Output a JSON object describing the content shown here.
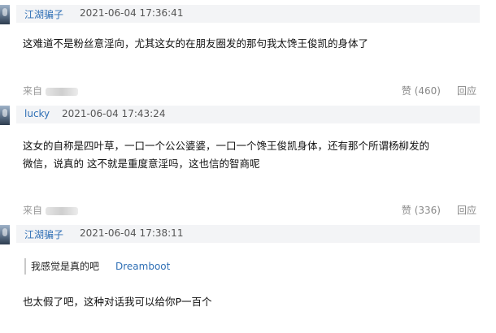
{
  "comments": [
    {
      "username": "江湖骗子",
      "time": "2021-06-04 17:36:41",
      "text": "这难道不是粉丝意淫向，尤其这女的在朋友圈发的那句我太馋王俊凯的身体了",
      "source": "来自",
      "like": "赞 (460)",
      "reply": "回应"
    },
    {
      "username": "lucky",
      "time": "2021-06-04 17:43:24",
      "text_line1": "这女的自称是四叶草，一口一个公公婆婆，一口一个馋王俊凯身体，还有那个所谓杨柳发的",
      "text_line2": "微信，说真的 这不就是重度意淫吗，这也信的智商呢",
      "source": "来自",
      "like": "赞 (336)",
      "reply": "回应"
    },
    {
      "username": "江湖骗子",
      "time": "2021-06-04 17:38:11",
      "quote_text": "我感觉是真的吧",
      "quote_author": "Dreamboot",
      "text": "也太假了吧，这种对话我可以给你P一百个"
    }
  ]
}
